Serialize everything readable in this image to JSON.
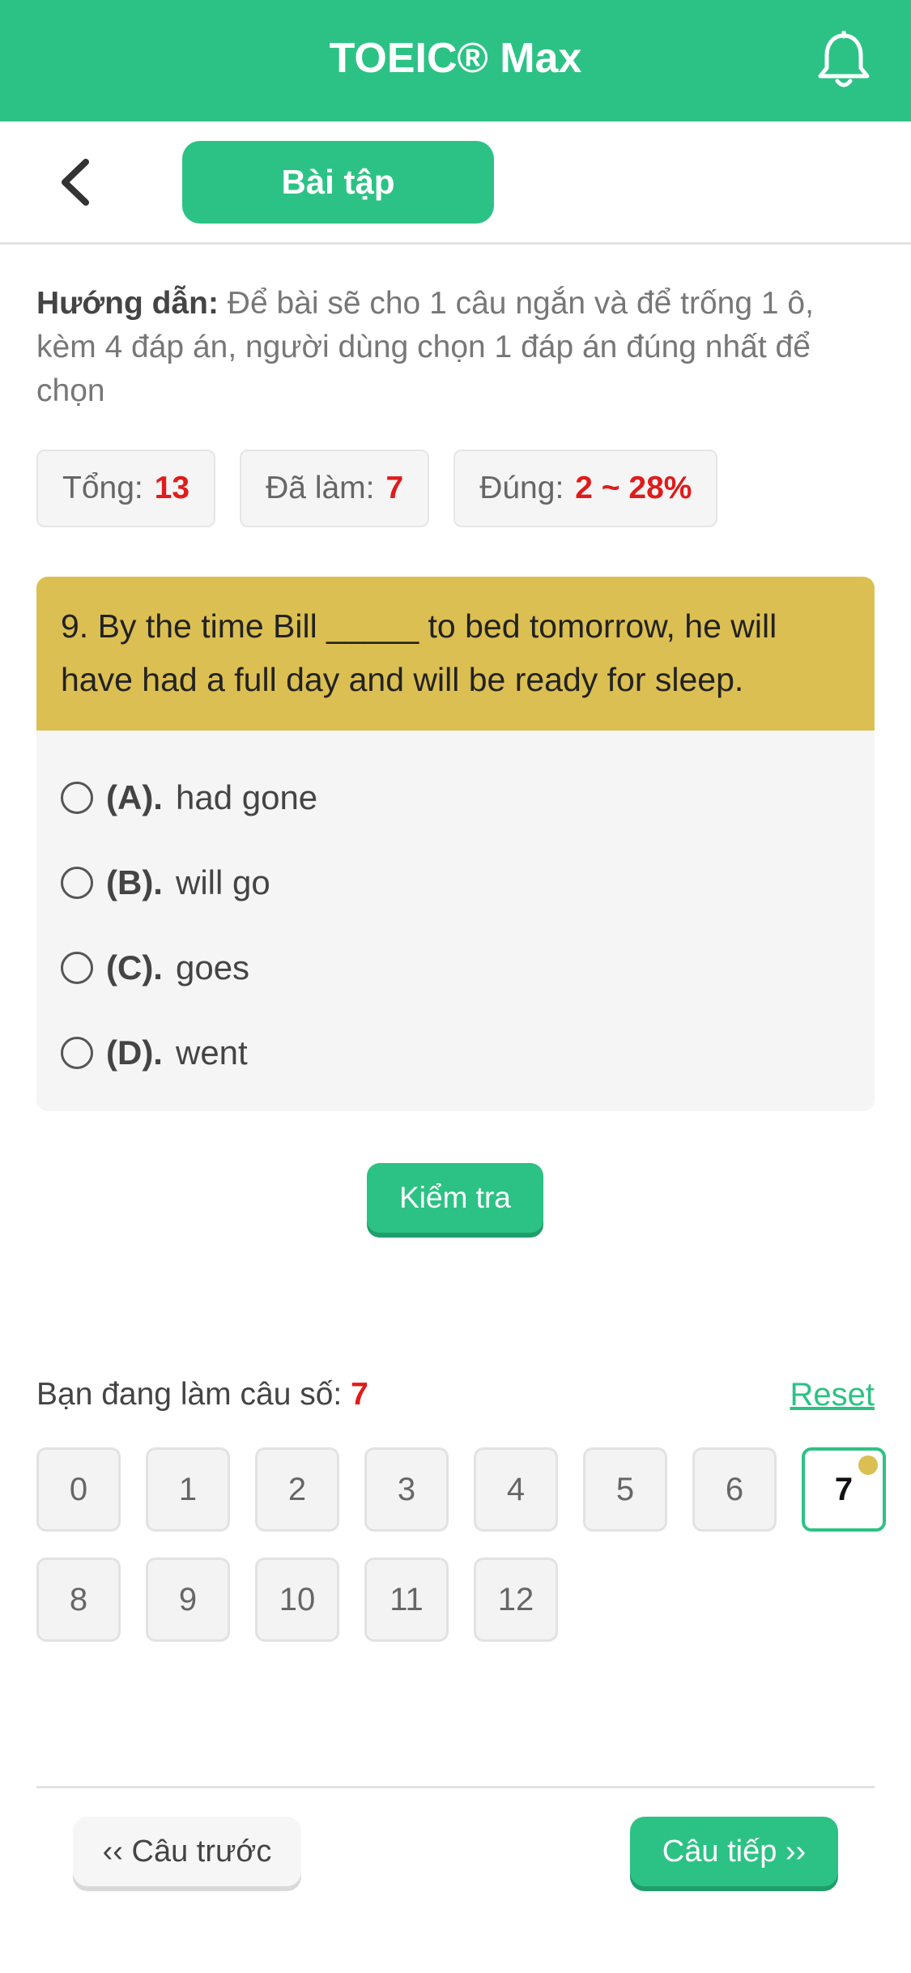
{
  "header": {
    "title": "TOEIC® Max",
    "bell_icon": "bell-icon"
  },
  "subbar": {
    "back_icon": "chevron-left-icon",
    "tab_label": "Bài tập"
  },
  "guide": {
    "label": "Hướng dẫn:",
    "text": " Để bài sẽ cho 1 câu ngắn và để trống 1 ô, kèm 4 đáp án, người dùng chọn 1 đáp án đúng nhất để chọn"
  },
  "stats": {
    "total_label": "Tổng:",
    "total_value": "13",
    "done_label": "Đã làm:",
    "done_value": "7",
    "correct_label": "Đúng:",
    "correct_value": "2 ~ 28%"
  },
  "question": {
    "text": "9. By the time Bill _____ to bed tomorrow, he will have had a full day and will be ready for sleep.",
    "options": [
      {
        "letter": "(A).",
        "text": "had gone"
      },
      {
        "letter": "(B).",
        "text": "will go"
      },
      {
        "letter": "(C).",
        "text": "goes"
      },
      {
        "letter": "(D).",
        "text": "went"
      }
    ]
  },
  "check_button": "Kiểm tra",
  "progress": {
    "label": "Bạn đang làm câu số: ",
    "current": "7",
    "reset": "Reset"
  },
  "grid": [
    "0",
    "1",
    "2",
    "3",
    "4",
    "5",
    "6",
    "7",
    "8",
    "9",
    "10",
    "11",
    "12"
  ],
  "nav": {
    "prev": "‹‹ Câu trước",
    "next": "Câu tiếp ››"
  },
  "colors": {
    "brand": "#2dc285",
    "question_header": "#dbbf52",
    "highlight": "#e01b1b"
  }
}
